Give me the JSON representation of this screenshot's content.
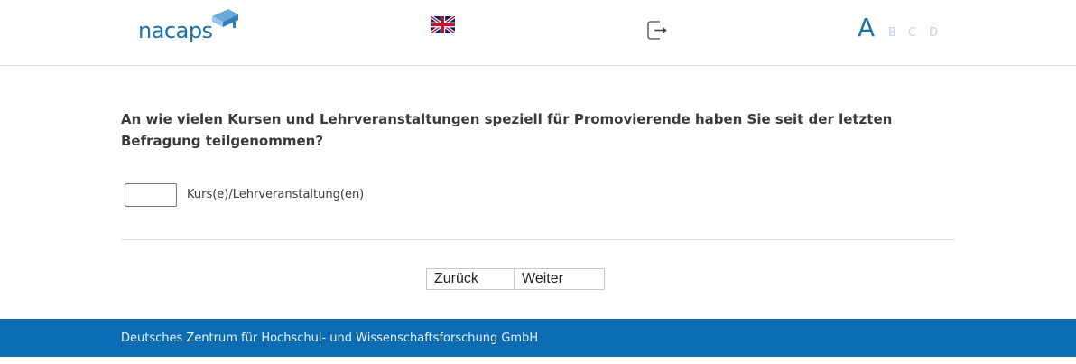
{
  "header": {
    "logo_text": "nacaps",
    "language_flag": "uk-flag-icon",
    "logout_icon": "logout-icon",
    "font_sizes": [
      "A",
      "B",
      "C",
      "D"
    ]
  },
  "question": {
    "text": "An wie vielen Kursen und Lehrveranstaltungen speziell für Promovierende haben Sie seit der letzten Befragung teilgenommen?",
    "input_value": "",
    "unit_label": "Kurs(e)/Lehrveranstaltung(en)"
  },
  "navigation": {
    "back_label": "Zurück",
    "next_label": "Weiter"
  },
  "footer": {
    "text": "Deutsches Zentrum für Hochschul- und Wissenschaftsforschung GmbH"
  },
  "colors": {
    "brand_blue": "#1c6fb0",
    "footer_blue": "#0b6bb3",
    "font_size_inactive": "#b9d3ea"
  }
}
